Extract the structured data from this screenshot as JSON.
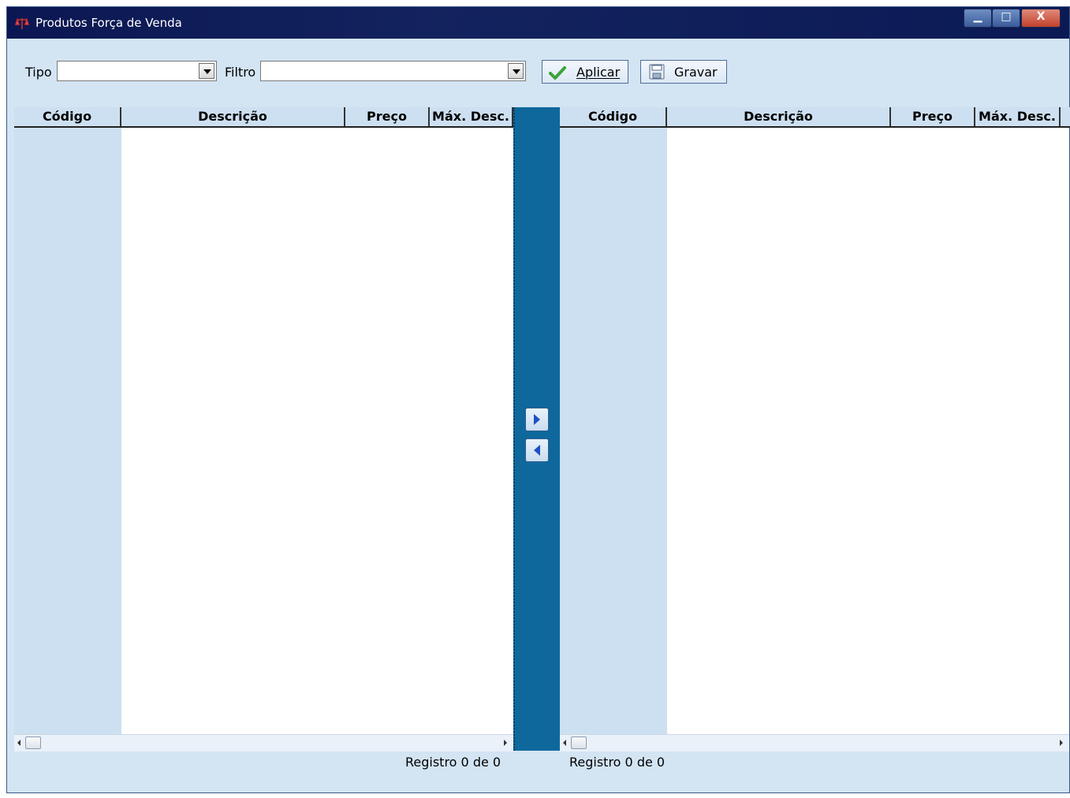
{
  "window": {
    "title": "Produtos Força de Venda"
  },
  "toolbar": {
    "tipo_label": "Tipo",
    "tipo_value": "",
    "filtro_label": "Filtro",
    "filtro_value": "",
    "aplicar_label": "Aplicar",
    "gravar_label": "Gravar"
  },
  "left_grid": {
    "columns": [
      "Código",
      "Descrição",
      "Preço",
      "Máx. Desc."
    ],
    "status": "Registro 0 de 0"
  },
  "right_grid": {
    "columns": [
      "Código",
      "Descrição",
      "Preço",
      "Máx. Desc."
    ],
    "status": "Registro 0 de 0"
  },
  "colors": {
    "titlebar": "#0b1752",
    "background": "#d3e4f3",
    "splitter": "#0e689c",
    "accent_green": "#3aa33a"
  }
}
